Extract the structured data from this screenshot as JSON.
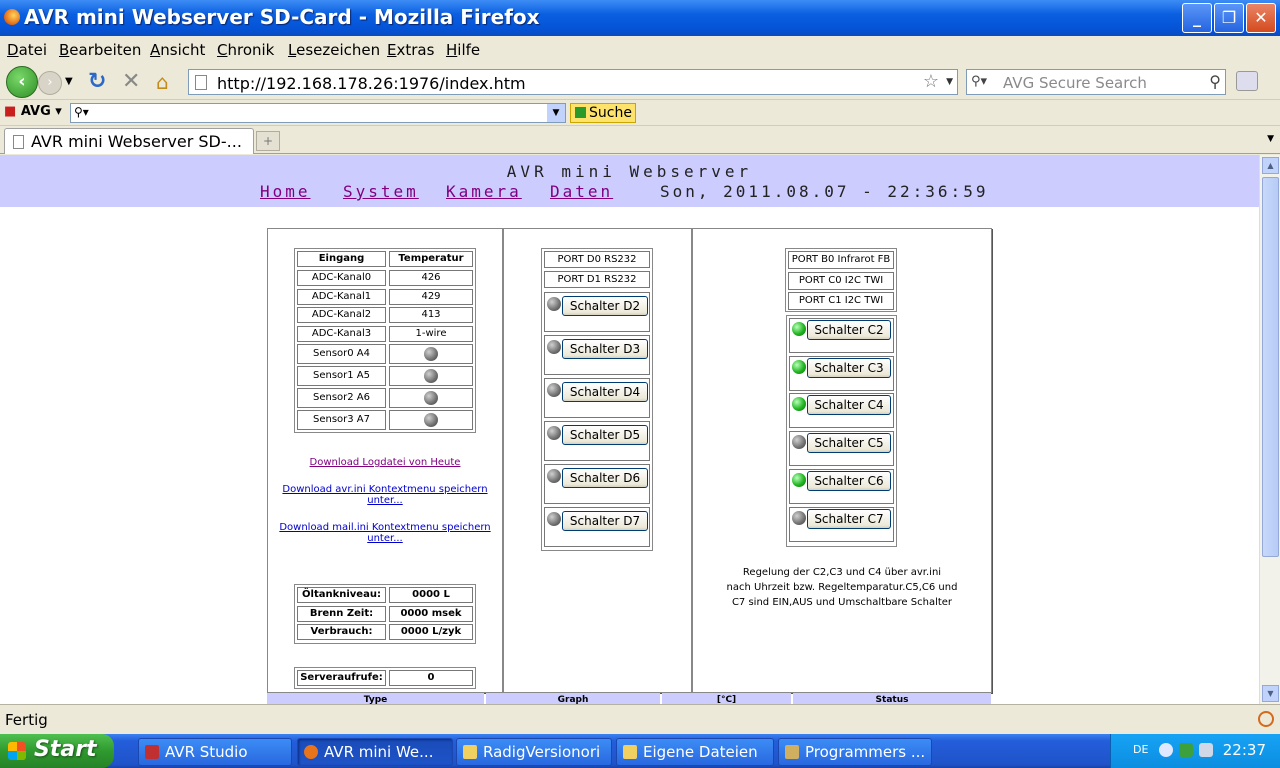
{
  "window": {
    "title": "AVR mini Webserver SD-Card - Mozilla Firefox"
  },
  "menu": [
    "Datei",
    "Bearbeiten",
    "Ansicht",
    "Chronik",
    "Lesezeichen",
    "Extras",
    "Hilfe"
  ],
  "nav": {
    "url": "http://192.168.178.26:1976/index.htm",
    "search_placeholder": "AVG Secure Search"
  },
  "avg": {
    "logo": "AVG",
    "search_button": "Suche"
  },
  "tab": {
    "label": "AVR mini Webserver SD-..."
  },
  "page": {
    "site_title": "AVR mini Webserver",
    "nav_links": [
      "Home",
      "System",
      "Kamera",
      "Daten"
    ],
    "datetime": "Son, 2011.08.07 - 22:36:59"
  },
  "adc_table": {
    "headers": [
      "Eingang",
      "Temperatur"
    ],
    "rows": [
      [
        "ADC-Kanal0",
        "426"
      ],
      [
        "ADC-Kanal1",
        "429"
      ],
      [
        "ADC-Kanal2",
        "413"
      ],
      [
        "ADC-Kanal3",
        "1-wire"
      ]
    ],
    "sensors": [
      "Sensor0 A4",
      "Sensor1 A5",
      "Sensor2 A6",
      "Sensor3 A7"
    ]
  },
  "downloads": [
    {
      "label": "Download Logdatei von Heute",
      "color": "#800080"
    },
    {
      "label": "Download avr.ini Kontextmenu speichern unter...",
      "color": "#0000cc"
    },
    {
      "label": "Download mail.ini Kontextmenu speichern unter...",
      "color": "#0000cc"
    }
  ],
  "oil_table": [
    [
      "Öltankniveau:",
      "0000 L"
    ],
    [
      "Brenn Zeit:",
      "0000 msek"
    ],
    [
      "Verbrauch:",
      "0000 L/zyk"
    ]
  ],
  "server_calls": {
    "label": "Serveraufrufe:",
    "value": "0"
  },
  "port_d": {
    "labels": [
      "PORT D0 RS232",
      "PORT D1 RS232"
    ],
    "switches": [
      {
        "label": "Schalter D2",
        "on": false
      },
      {
        "label": "Schalter D3",
        "on": false
      },
      {
        "label": "Schalter D4",
        "on": false
      },
      {
        "label": "Schalter D5",
        "on": false
      },
      {
        "label": "Schalter D6",
        "on": false
      },
      {
        "label": "Schalter D7",
        "on": false
      }
    ]
  },
  "port_c": {
    "labels": [
      "PORT B0 Infrarot FB",
      "PORT C0 I2C TWI",
      "PORT C1 I2C TWI"
    ],
    "switches": [
      {
        "label": "Schalter C2",
        "on": true
      },
      {
        "label": "Schalter C3",
        "on": true
      },
      {
        "label": "Schalter C4",
        "on": true
      },
      {
        "label": "Schalter C5",
        "on": false
      },
      {
        "label": "Schalter C6",
        "on": true
      },
      {
        "label": "Schalter C7",
        "on": false
      }
    ],
    "note": [
      "Regelung der C2,C3 und C4 über avr.ini",
      "nach Uhrzeit bzw. Regeltemparatur.C5,C6 und",
      "C7 sind EIN,AUS und Umschaltbare Schalter"
    ]
  },
  "bottom_headers": [
    "Type",
    "Graph",
    "[°C]",
    "Status"
  ],
  "status": {
    "text": "Fertig"
  },
  "taskbar": {
    "start": "Start",
    "tasks": [
      "AVR Studio",
      "AVR mini We...",
      "RadigVersionori",
      "Eigene Dateien",
      "Programmers ..."
    ],
    "lang": "DE",
    "clock": "22:37"
  }
}
